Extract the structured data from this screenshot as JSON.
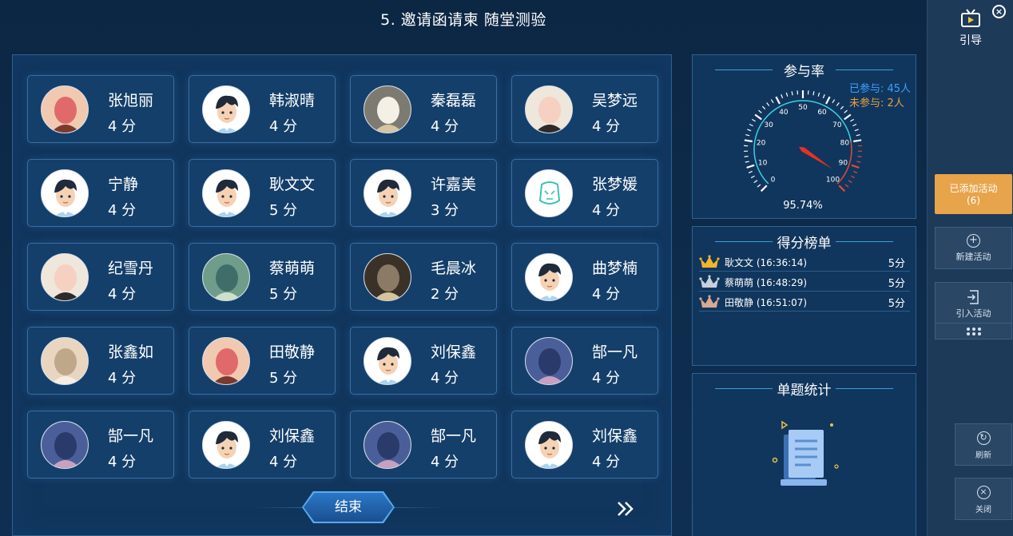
{
  "page": {
    "title": "5. 邀请函请柬 随堂测验"
  },
  "students": [
    {
      "name": "张旭丽",
      "score": "4 分",
      "avatar": "photo-girl"
    },
    {
      "name": "韩淑晴",
      "score": "4 分",
      "avatar": "default-boy"
    },
    {
      "name": "秦磊磊",
      "score": "4 分",
      "avatar": "photo-cat"
    },
    {
      "name": "吴梦远",
      "score": "4 分",
      "avatar": "photo-girl-cat"
    },
    {
      "name": "宁静",
      "score": "4 分",
      "avatar": "default-boy"
    },
    {
      "name": "耿文文",
      "score": "5 分",
      "avatar": "default-boy"
    },
    {
      "name": "许嘉美",
      "score": "3 分",
      "avatar": "default-boy"
    },
    {
      "name": "张梦媛",
      "score": "4 分",
      "avatar": "teal-icon"
    },
    {
      "name": "纪雪丹",
      "score": "4 分",
      "avatar": "photo-girl-cat"
    },
    {
      "name": "蔡萌萌",
      "score": "5 分",
      "avatar": "photo-painting"
    },
    {
      "name": "毛晨冰",
      "score": "2 分",
      "avatar": "photo-girl-blonde"
    },
    {
      "name": "曲梦楠",
      "score": "4 分",
      "avatar": "default-boy"
    },
    {
      "name": "张鑫如",
      "score": "4 分",
      "avatar": "photo-dog"
    },
    {
      "name": "田敬静",
      "score": "5 分",
      "avatar": "photo-girl"
    },
    {
      "name": "刘保鑫",
      "score": "4 分",
      "avatar": "default-boy"
    },
    {
      "name": "郜一凡",
      "score": "4 分",
      "avatar": "photo-group"
    },
    {
      "name": "郜一凡",
      "score": "4 分",
      "avatar": "photo-group"
    },
    {
      "name": "刘保鑫",
      "score": "4 分",
      "avatar": "default-boy"
    },
    {
      "name": "郜一凡",
      "score": "4 分",
      "avatar": "photo-group"
    },
    {
      "name": "刘保鑫",
      "score": "4 分",
      "avatar": "default-boy"
    }
  ],
  "end_button": "结束",
  "next_icon": "double-chevron-right-icon",
  "participation": {
    "title": "参与率",
    "joined": "已参与: 45人",
    "missing": "未参与: 2人",
    "rate_text": "95.74%",
    "rate_value": 95.74,
    "gauge_ticks": [
      "0",
      "10",
      "20",
      "30",
      "40",
      "50",
      "60",
      "70",
      "80",
      "90",
      "100"
    ],
    "colors": {
      "joined": "#3ea0ff",
      "missing": "#e8a040",
      "needle": "#e8321e",
      "arc": "#3ad0e0",
      "danger": "#e04a3a"
    }
  },
  "leaderboard": {
    "title": "得分榜单",
    "rows": [
      {
        "name": "耿文文 (16:36:14)",
        "score": "5分",
        "crown": "gold"
      },
      {
        "name": "蔡萌萌 (16:48:29)",
        "score": "5分",
        "crown": "silver"
      },
      {
        "name": "田敬静 (16:51:07)",
        "score": "5分",
        "crown": "bronze"
      }
    ]
  },
  "question_stats": {
    "title": "单题统计"
  },
  "sidebar": {
    "guide": "引导",
    "added": "已添加活动",
    "added_count": "(6)",
    "new_activity": "新建活动",
    "import_activity": "引入活动",
    "refresh": "刷新",
    "close": "关闭"
  }
}
